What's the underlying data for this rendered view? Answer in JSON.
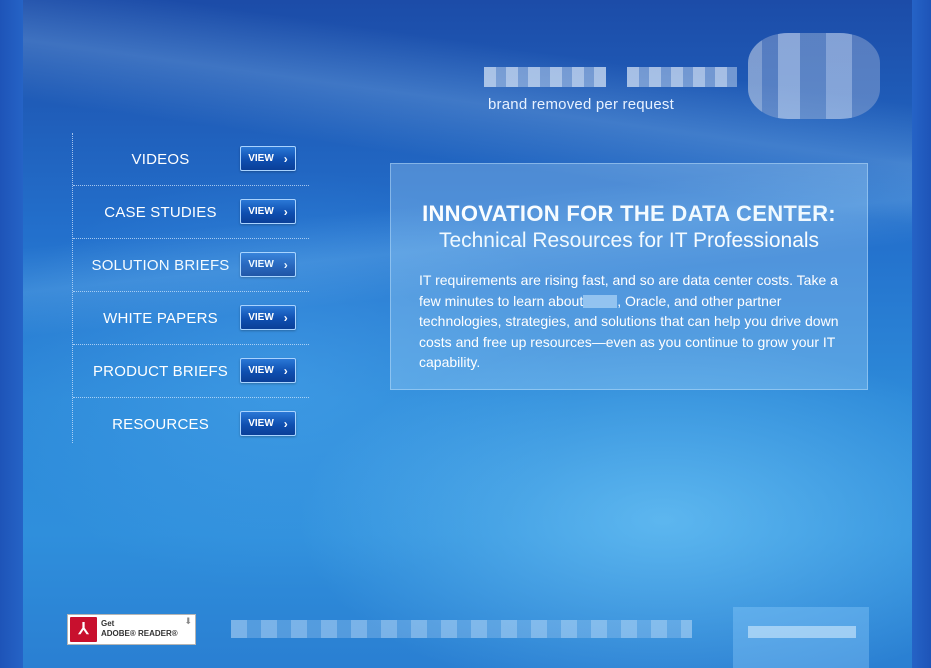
{
  "brand": {
    "caption": "brand removed per request"
  },
  "nav": {
    "items": [
      {
        "label": "VIDEOS",
        "button": "VIEW"
      },
      {
        "label": "CASE STUDIES",
        "button": "VIEW"
      },
      {
        "label": "SOLUTION BRIEFS",
        "button": "VIEW"
      },
      {
        "label": "WHITE PAPERS",
        "button": "VIEW"
      },
      {
        "label": "PRODUCT BRIEFS",
        "button": "VIEW"
      },
      {
        "label": "RESOURCES",
        "button": "VIEW"
      }
    ]
  },
  "content": {
    "title": "INNOVATION FOR THE DATA CENTER:",
    "subtitle": "Technical Resources for IT Professionals",
    "body_start": "IT requirements are rising fast, and so are data center costs. Take a few minutes to learn about",
    "body_end": ", Oracle, and other partner technologies, strategies, and solutions that can help you drive down costs and free up resources—even as you continue to grow your IT capability."
  },
  "footer": {
    "adobe": {
      "get": "Get",
      "name": "ADOBE® READER®"
    }
  },
  "colors": {
    "background": "#2370cc",
    "button": "#0f4fb0",
    "adobe_red": "#c8102e"
  }
}
